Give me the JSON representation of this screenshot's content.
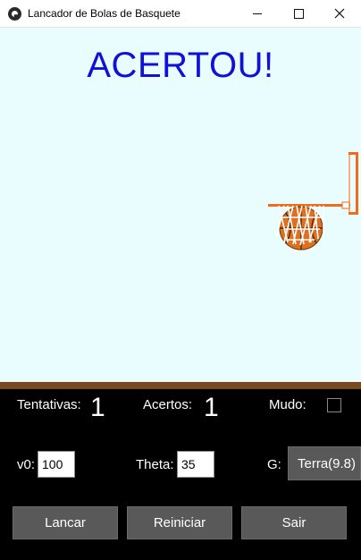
{
  "window": {
    "title": "Lancador de Bolas de Basquete"
  },
  "game": {
    "message": "ACERTOU!"
  },
  "stats": {
    "tentativas_label": "Tentativas:",
    "tentativas_value": "1",
    "acertos_label": "Acertos:",
    "acertos_value": "1",
    "mudo_label": "Mudo:",
    "mudo_checked": false
  },
  "params": {
    "v0_label": "v0:",
    "v0_value": "100",
    "theta_label": "Theta:",
    "theta_value": "35",
    "g_label": "G:",
    "g_value": "Terra(9.8)"
  },
  "buttons": {
    "lancar": "Lancar",
    "reiniciar": "Reiniciar",
    "sair": "Sair"
  },
  "colors": {
    "sky": "#e9fcfe",
    "message": "#1010d8",
    "floor": "#7a4a1f",
    "hoop": "#f26a1b",
    "ball": "#e0701f",
    "panel": "#000000",
    "button": "#595959"
  }
}
